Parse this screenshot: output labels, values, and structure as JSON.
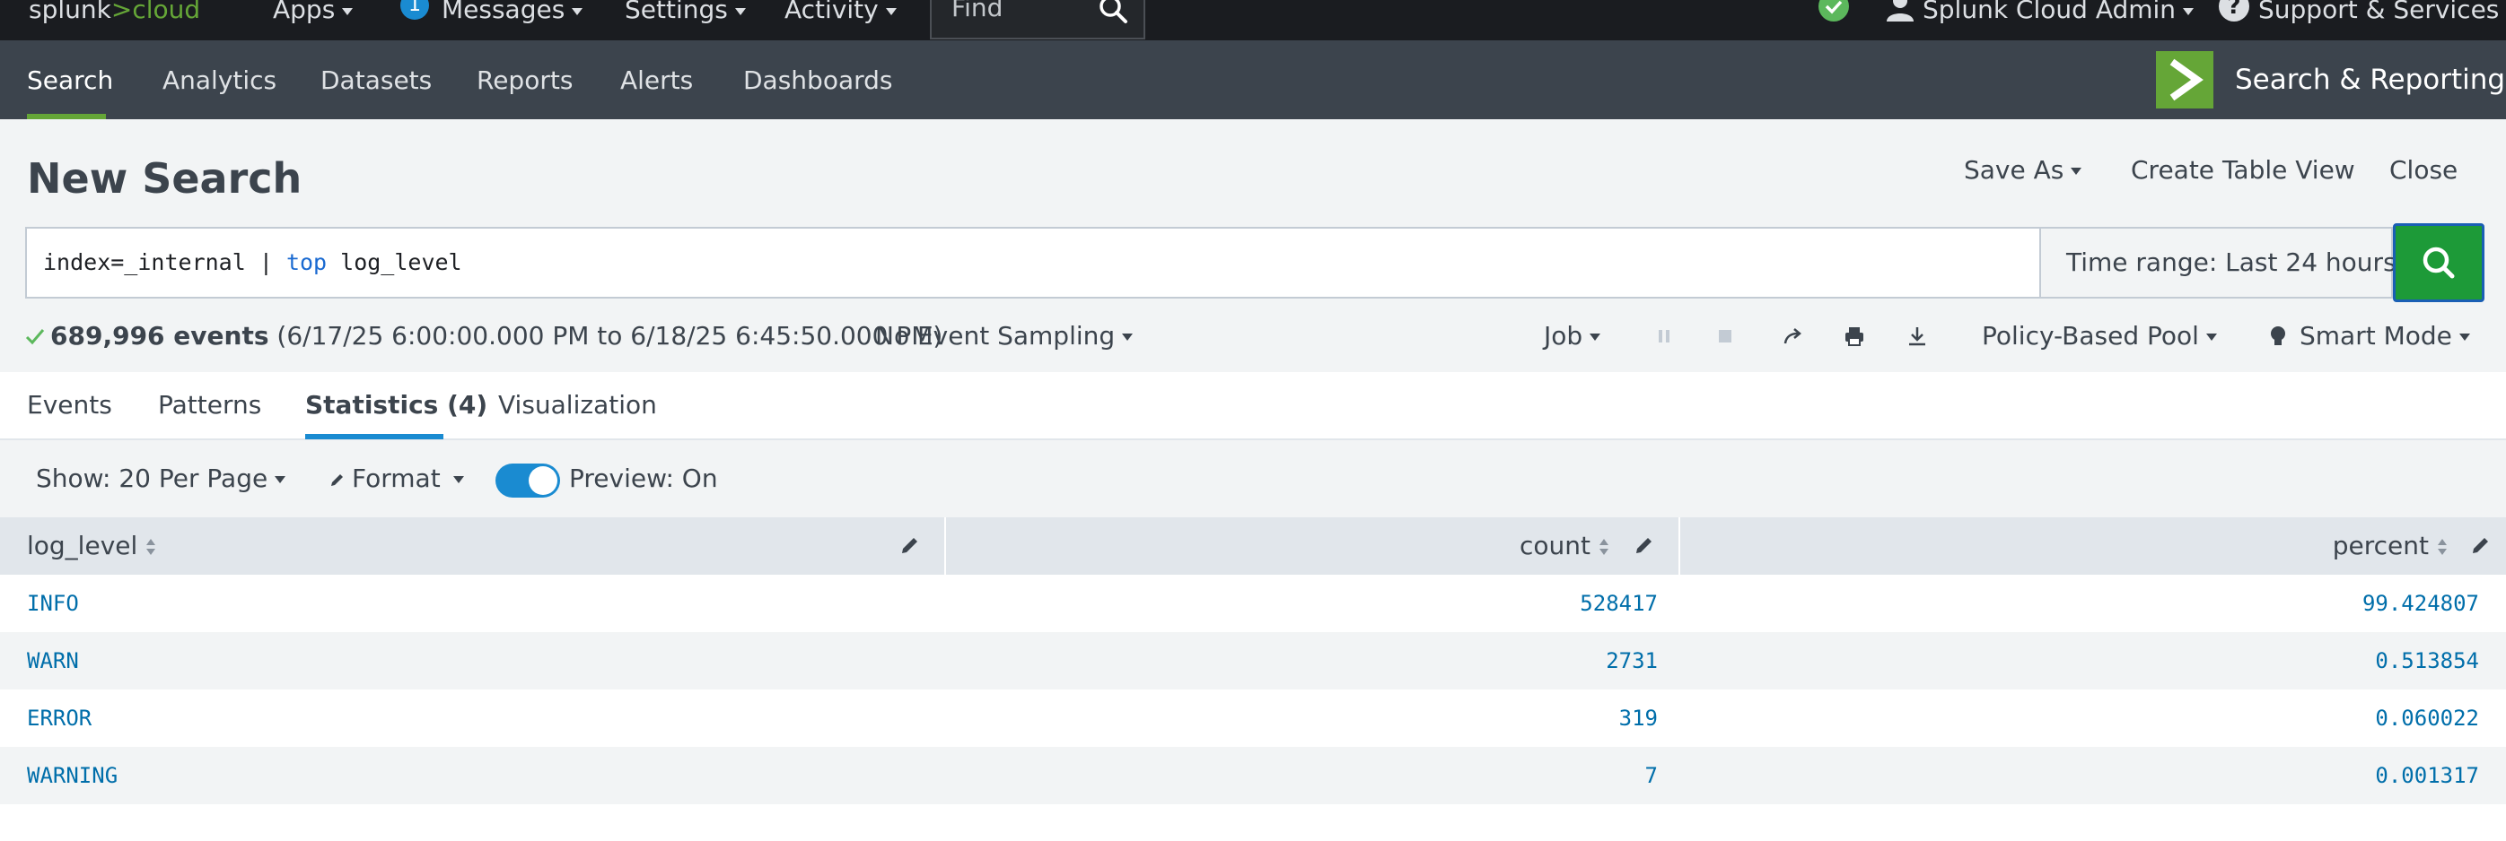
{
  "topbar": {
    "logo": {
      "main": "splunk",
      "sep": ">",
      "product": "cloud"
    },
    "menus": [
      "Apps",
      "Messages",
      "Settings",
      "Activity"
    ],
    "messages_count": "1",
    "find_placeholder": "Find",
    "user_label": "Splunk Cloud Admin",
    "support_label": "Support & Services"
  },
  "appnav": {
    "items": [
      "Search",
      "Analytics",
      "Datasets",
      "Reports",
      "Alerts",
      "Dashboards"
    ],
    "active": "Search",
    "app_title": "Search & Reporting"
  },
  "header": {
    "title": "New Search",
    "save_as": "Save As",
    "create_table_view": "Create Table View",
    "close": "Close"
  },
  "search": {
    "query_prefix": "index=_internal | ",
    "query_keyword": "top",
    "query_suffix": " log_level",
    "time_range": "Time range: Last 24 hours"
  },
  "status": {
    "events": "689,996 events",
    "range": "(6/17/25 6:00:00.000 PM to 6/18/25 6:45:50.000 PM)",
    "sampling": "No Event Sampling",
    "job": "Job",
    "pool": "Policy-Based Pool",
    "mode": "Smart Mode"
  },
  "tabs": [
    {
      "label": "Events"
    },
    {
      "label": "Patterns"
    },
    {
      "label": "Statistics (4)",
      "active": true
    },
    {
      "label": "Visualization"
    }
  ],
  "options": {
    "per_page": "Show: 20 Per Page",
    "format": "Format",
    "preview": "Preview: On",
    "preview_on": true
  },
  "table": {
    "columns": [
      "log_level",
      "count",
      "percent"
    ],
    "rows": [
      [
        "INFO",
        "528417",
        "99.424807"
      ],
      [
        "WARN",
        "2731",
        "0.513854"
      ],
      [
        "ERROR",
        "319",
        "0.060022"
      ],
      [
        "WARNING",
        "7",
        "0.001317"
      ]
    ]
  },
  "colors": {
    "topbar_bg": "#1a1c20",
    "appnav_bg": "#3c444d",
    "accent_green": "#65a637",
    "search_button": "#1d9a38",
    "link_blue": "#006eaa",
    "tab_active": "#1a8bd1"
  },
  "icons": [
    "search-icon",
    "check-circle-icon",
    "user-icon",
    "help-icon",
    "pause-icon",
    "stop-icon",
    "share-icon",
    "print-icon",
    "download-icon",
    "lightbulb-icon",
    "pencil-icon",
    "sort-icon",
    "checkmark-icon",
    "app-logo-icon"
  ]
}
